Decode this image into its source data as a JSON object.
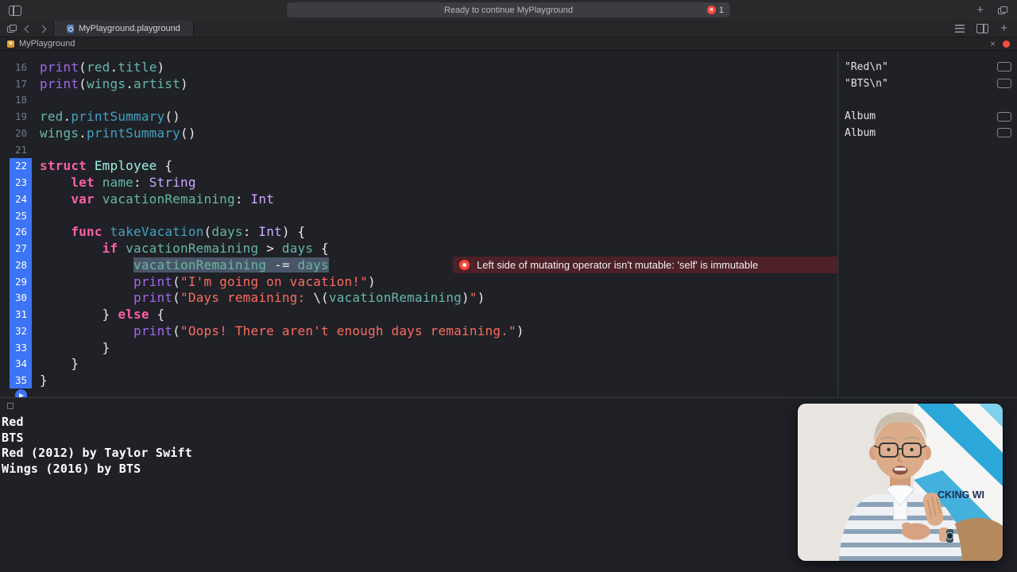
{
  "window": {
    "status": "Ready to continue MyPlayground",
    "error_count": "1"
  },
  "tab_bar": {
    "tab_label": "MyPlayground.playground"
  },
  "jump_bar": {
    "item": "MyPlayground"
  },
  "editor": {
    "lines": [
      {
        "n": 16,
        "tokens": [
          {
            "c": "fn",
            "t": "print"
          },
          {
            "c": "pl",
            "t": "("
          },
          {
            "c": "pv",
            "t": "red"
          },
          {
            "c": "pl",
            "t": "."
          },
          {
            "c": "pv",
            "t": "title"
          },
          {
            "c": "pl",
            "t": ")"
          }
        ]
      },
      {
        "n": 17,
        "tokens": [
          {
            "c": "fn",
            "t": "print"
          },
          {
            "c": "pl",
            "t": "("
          },
          {
            "c": "pv",
            "t": "wings"
          },
          {
            "c": "pl",
            "t": "."
          },
          {
            "c": "pv",
            "t": "artist"
          },
          {
            "c": "pl",
            "t": ")"
          }
        ]
      },
      {
        "n": 18,
        "tokens": []
      },
      {
        "n": 19,
        "tokens": [
          {
            "c": "pv",
            "t": "red"
          },
          {
            "c": "pl",
            "t": "."
          },
          {
            "c": "pm",
            "t": "printSummary"
          },
          {
            "c": "pl",
            "t": "()"
          }
        ]
      },
      {
        "n": 20,
        "tokens": [
          {
            "c": "pv",
            "t": "wings"
          },
          {
            "c": "pl",
            "t": "."
          },
          {
            "c": "pm",
            "t": "printSummary"
          },
          {
            "c": "pl",
            "t": "()"
          }
        ]
      },
      {
        "n": 21,
        "tokens": []
      },
      {
        "n": 22,
        "blue": true,
        "tokens": [
          {
            "c": "kw",
            "t": "struct"
          },
          {
            "c": "pl",
            "t": " "
          },
          {
            "c": "pt",
            "t": "Employee"
          },
          {
            "c": "pl",
            "t": " {"
          }
        ]
      },
      {
        "n": 23,
        "blue": true,
        "tokens": [
          {
            "c": "pl",
            "t": "    "
          },
          {
            "c": "kw",
            "t": "let"
          },
          {
            "c": "pl",
            "t": " "
          },
          {
            "c": "pv",
            "t": "name"
          },
          {
            "c": "pl",
            "t": ": "
          },
          {
            "c": "ty",
            "t": "String"
          }
        ]
      },
      {
        "n": 24,
        "blue": true,
        "tokens": [
          {
            "c": "pl",
            "t": "    "
          },
          {
            "c": "kw",
            "t": "var"
          },
          {
            "c": "pl",
            "t": " "
          },
          {
            "c": "pv",
            "t": "vacationRemaining"
          },
          {
            "c": "pl",
            "t": ": "
          },
          {
            "c": "ty",
            "t": "Int"
          }
        ]
      },
      {
        "n": 25,
        "blue": true,
        "tokens": []
      },
      {
        "n": 26,
        "blue": true,
        "tokens": [
          {
            "c": "pl",
            "t": "    "
          },
          {
            "c": "kw",
            "t": "func"
          },
          {
            "c": "pl",
            "t": " "
          },
          {
            "c": "pm",
            "t": "takeVacation"
          },
          {
            "c": "pl",
            "t": "("
          },
          {
            "c": "pv",
            "t": "days"
          },
          {
            "c": "pl",
            "t": ": "
          },
          {
            "c": "ty",
            "t": "Int"
          },
          {
            "c": "pl",
            "t": ") {"
          }
        ]
      },
      {
        "n": 27,
        "blue": true,
        "tokens": [
          {
            "c": "pl",
            "t": "        "
          },
          {
            "c": "kw",
            "t": "if"
          },
          {
            "c": "pl",
            "t": " "
          },
          {
            "c": "pv",
            "t": "vacationRemaining"
          },
          {
            "c": "pl",
            "t": " > "
          },
          {
            "c": "pv",
            "t": "days"
          },
          {
            "c": "pl",
            "t": " {"
          }
        ]
      },
      {
        "n": 28,
        "blue": true,
        "error": "Left side of mutating operator isn't mutable: 'self' is immutable",
        "tokens": [
          {
            "c": "pl",
            "t": "            "
          },
          {
            "c": "pv",
            "t": "vacationRemaining",
            "sel": true
          },
          {
            "c": "pl",
            "t": " -= ",
            "sel": true
          },
          {
            "c": "pv",
            "t": "days",
            "sel": true
          }
        ]
      },
      {
        "n": 29,
        "blue": true,
        "tokens": [
          {
            "c": "pl",
            "t": "            "
          },
          {
            "c": "fn",
            "t": "print"
          },
          {
            "c": "pl",
            "t": "("
          },
          {
            "c": "str",
            "t": "\"I'm going on vacation!\""
          },
          {
            "c": "pl",
            "t": ")"
          }
        ]
      },
      {
        "n": 30,
        "blue": true,
        "tokens": [
          {
            "c": "pl",
            "t": "            "
          },
          {
            "c": "fn",
            "t": "print"
          },
          {
            "c": "pl",
            "t": "("
          },
          {
            "c": "str",
            "t": "\"Days remaining: "
          },
          {
            "c": "pl",
            "t": "\\("
          },
          {
            "c": "pv",
            "t": "vacationRemaining"
          },
          {
            "c": "pl",
            "t": ")"
          },
          {
            "c": "str",
            "t": "\""
          },
          {
            "c": "pl",
            "t": ")"
          }
        ]
      },
      {
        "n": 31,
        "blue": true,
        "tokens": [
          {
            "c": "pl",
            "t": "        } "
          },
          {
            "c": "kw",
            "t": "else"
          },
          {
            "c": "pl",
            "t": " {"
          }
        ]
      },
      {
        "n": 32,
        "blue": true,
        "tokens": [
          {
            "c": "pl",
            "t": "            "
          },
          {
            "c": "fn",
            "t": "print"
          },
          {
            "c": "pl",
            "t": "("
          },
          {
            "c": "str",
            "t": "\"Oops! There aren't enough days remaining.\""
          },
          {
            "c": "pl",
            "t": ")"
          }
        ]
      },
      {
        "n": 33,
        "blue": true,
        "tokens": [
          {
            "c": "pl",
            "t": "        }"
          }
        ]
      },
      {
        "n": 34,
        "blue": true,
        "tokens": [
          {
            "c": "pl",
            "t": "    }"
          }
        ]
      },
      {
        "n": 35,
        "blue": true,
        "tokens": [
          {
            "c": "pl",
            "t": "}"
          }
        ]
      }
    ],
    "results": [
      {
        "line": 16,
        "value": "\"Red\\n\""
      },
      {
        "line": 17,
        "value": "\"BTS\\n\""
      },
      {
        "line": 19,
        "value": "Album"
      },
      {
        "line": 20,
        "value": "Album"
      }
    ]
  },
  "console": {
    "lines": [
      "Red",
      "BTS",
      "Red (2012) by Taylor Swift",
      "Wings (2016) by BTS"
    ]
  },
  "webcam": {
    "background_text": "CKING WI"
  },
  "colors": {
    "accent_blue": "#3D74F6",
    "error_red": "#FF453A",
    "error_banner_bg": "#4D2127",
    "selection": "#4A5569",
    "keyword": "#FC5FA3",
    "string": "#FC6A5D",
    "other_type": "#D0A8FF",
    "project_type": "#9EF1DD",
    "project_variable": "#67B7A4",
    "project_method": "#41A1C0",
    "library_function": "#A167E6"
  }
}
